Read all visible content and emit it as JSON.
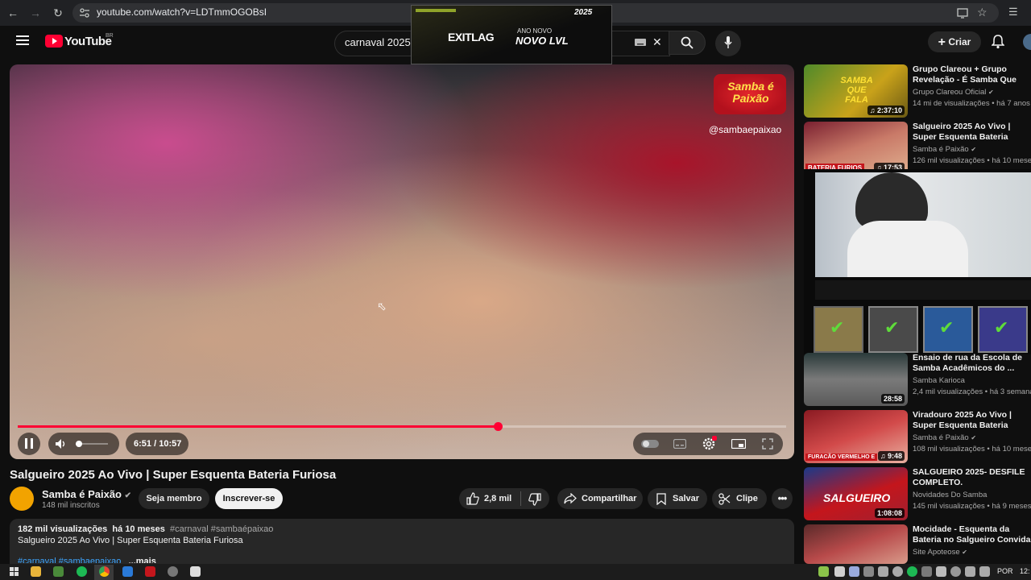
{
  "browser": {
    "url": "youtube.com/watch?v=LDTmmOGOBsI"
  },
  "yt": {
    "logo_text": "YouTube",
    "logo_region": "BR",
    "search_value": "carnaval 2025 e",
    "create_label": "Criar"
  },
  "ad": {
    "brand": "EXITLAG",
    "line1": "ANO NOVO",
    "line2": "NOVO LVL",
    "badge": "2025"
  },
  "video": {
    "watermark_logo": "Samba é Paixão",
    "watermark_handle": "@sambaepaixao",
    "time_current": "6:51",
    "time_total": "10:57",
    "progress_fraction": 0.625,
    "volume_fraction": 0.1,
    "title": "Salgueiro 2025 Ao Vivo | Super Esquenta Bateria Furiosa"
  },
  "channel": {
    "name": "Samba é Paixão",
    "subscribers": "148 mil inscritos",
    "member_label": "Seja membro",
    "subscribe_label": "Inscrever-se"
  },
  "actions": {
    "likes": "2,8 mil",
    "share": "Compartilhar",
    "save": "Salvar",
    "clip": "Clipe"
  },
  "description": {
    "views": "182 mil visualizações",
    "age": "há 10 meses",
    "tags": "#carnaval #sambaépaixao",
    "text": "Salgueiro 2025 Ao Vivo | Super Esquenta Bateria Furiosa",
    "tags2": "#carnaval #sambaepaixao",
    "more": "...mais"
  },
  "recommendations": [
    {
      "title": "Grupo Clareou + Grupo Revelação - É Samba Que Fala...",
      "channel": "Grupo Clareou Oficial",
      "meta": "14 mi de visualizações • há 7 anos",
      "duration": "2:37:10",
      "thumb_text": "SAMBA QUE FALA"
    },
    {
      "title": "Salgueiro 2025 Ao Vivo | Super Esquenta Bateria Furiosa | ...",
      "channel": "Samba é Paixão",
      "meta": "126 mil visualizações • há 10 meses",
      "duration": "17:53",
      "thumb_text": "BATERIA FURIOS"
    },
    {
      "title": "Ensaio de rua da Escola de Samba Acadêmicos do ...",
      "channel": "Samba Karioca",
      "meta": "2,4 mil visualizações • há 3 semanas",
      "duration": "28:58",
      "thumb_text": ""
    },
    {
      "title": "Viradouro 2025 Ao Vivo | Super Esquenta Bateria Furacão ...",
      "channel": "Samba é Paixão",
      "meta": "108 mil visualizações • há 10 meses",
      "duration": "9:48",
      "thumb_text": "FURACÃO VERMELHO E"
    },
    {
      "title": "SALGUEIRO 2025- DESFILE COMPLETO.",
      "channel": "Novidades Do Samba",
      "meta": "145 mil visualizações • há 9 meses",
      "duration": "1:08:08",
      "thumb_text": "SALGUEIRO"
    },
    {
      "title": "Mocidade - Esquenta da Bateria no Salgueiro Convida - ...",
      "channel": "Site Apoteose",
      "meta": "",
      "duration": "",
      "thumb_text": ""
    }
  ],
  "taskbar": {
    "lang": "POR",
    "clock": "12:"
  },
  "colors": {
    "accent_red": "#ff0033",
    "bg": "#0f0f0f",
    "pill": "#272727"
  }
}
